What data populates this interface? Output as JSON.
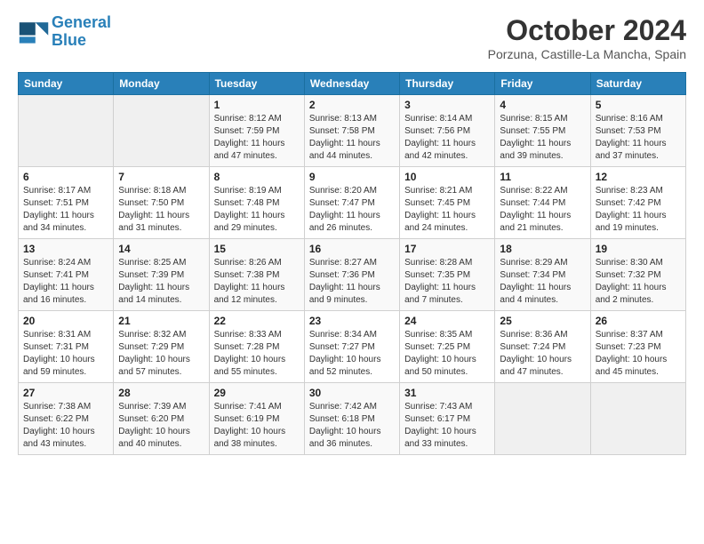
{
  "header": {
    "logo_line1": "General",
    "logo_line2": "Blue",
    "month": "October 2024",
    "location": "Porzuna, Castille-La Mancha, Spain"
  },
  "weekdays": [
    "Sunday",
    "Monday",
    "Tuesday",
    "Wednesday",
    "Thursday",
    "Friday",
    "Saturday"
  ],
  "weeks": [
    [
      {
        "day": "",
        "info": ""
      },
      {
        "day": "",
        "info": ""
      },
      {
        "day": "1",
        "info": "Sunrise: 8:12 AM\nSunset: 7:59 PM\nDaylight: 11 hours and 47 minutes."
      },
      {
        "day": "2",
        "info": "Sunrise: 8:13 AM\nSunset: 7:58 PM\nDaylight: 11 hours and 44 minutes."
      },
      {
        "day": "3",
        "info": "Sunrise: 8:14 AM\nSunset: 7:56 PM\nDaylight: 11 hours and 42 minutes."
      },
      {
        "day": "4",
        "info": "Sunrise: 8:15 AM\nSunset: 7:55 PM\nDaylight: 11 hours and 39 minutes."
      },
      {
        "day": "5",
        "info": "Sunrise: 8:16 AM\nSunset: 7:53 PM\nDaylight: 11 hours and 37 minutes."
      }
    ],
    [
      {
        "day": "6",
        "info": "Sunrise: 8:17 AM\nSunset: 7:51 PM\nDaylight: 11 hours and 34 minutes."
      },
      {
        "day": "7",
        "info": "Sunrise: 8:18 AM\nSunset: 7:50 PM\nDaylight: 11 hours and 31 minutes."
      },
      {
        "day": "8",
        "info": "Sunrise: 8:19 AM\nSunset: 7:48 PM\nDaylight: 11 hours and 29 minutes."
      },
      {
        "day": "9",
        "info": "Sunrise: 8:20 AM\nSunset: 7:47 PM\nDaylight: 11 hours and 26 minutes."
      },
      {
        "day": "10",
        "info": "Sunrise: 8:21 AM\nSunset: 7:45 PM\nDaylight: 11 hours and 24 minutes."
      },
      {
        "day": "11",
        "info": "Sunrise: 8:22 AM\nSunset: 7:44 PM\nDaylight: 11 hours and 21 minutes."
      },
      {
        "day": "12",
        "info": "Sunrise: 8:23 AM\nSunset: 7:42 PM\nDaylight: 11 hours and 19 minutes."
      }
    ],
    [
      {
        "day": "13",
        "info": "Sunrise: 8:24 AM\nSunset: 7:41 PM\nDaylight: 11 hours and 16 minutes."
      },
      {
        "day": "14",
        "info": "Sunrise: 8:25 AM\nSunset: 7:39 PM\nDaylight: 11 hours and 14 minutes."
      },
      {
        "day": "15",
        "info": "Sunrise: 8:26 AM\nSunset: 7:38 PM\nDaylight: 11 hours and 12 minutes."
      },
      {
        "day": "16",
        "info": "Sunrise: 8:27 AM\nSunset: 7:36 PM\nDaylight: 11 hours and 9 minutes."
      },
      {
        "day": "17",
        "info": "Sunrise: 8:28 AM\nSunset: 7:35 PM\nDaylight: 11 hours and 7 minutes."
      },
      {
        "day": "18",
        "info": "Sunrise: 8:29 AM\nSunset: 7:34 PM\nDaylight: 11 hours and 4 minutes."
      },
      {
        "day": "19",
        "info": "Sunrise: 8:30 AM\nSunset: 7:32 PM\nDaylight: 11 hours and 2 minutes."
      }
    ],
    [
      {
        "day": "20",
        "info": "Sunrise: 8:31 AM\nSunset: 7:31 PM\nDaylight: 10 hours and 59 minutes."
      },
      {
        "day": "21",
        "info": "Sunrise: 8:32 AM\nSunset: 7:29 PM\nDaylight: 10 hours and 57 minutes."
      },
      {
        "day": "22",
        "info": "Sunrise: 8:33 AM\nSunset: 7:28 PM\nDaylight: 10 hours and 55 minutes."
      },
      {
        "day": "23",
        "info": "Sunrise: 8:34 AM\nSunset: 7:27 PM\nDaylight: 10 hours and 52 minutes."
      },
      {
        "day": "24",
        "info": "Sunrise: 8:35 AM\nSunset: 7:25 PM\nDaylight: 10 hours and 50 minutes."
      },
      {
        "day": "25",
        "info": "Sunrise: 8:36 AM\nSunset: 7:24 PM\nDaylight: 10 hours and 47 minutes."
      },
      {
        "day": "26",
        "info": "Sunrise: 8:37 AM\nSunset: 7:23 PM\nDaylight: 10 hours and 45 minutes."
      }
    ],
    [
      {
        "day": "27",
        "info": "Sunrise: 7:38 AM\nSunset: 6:22 PM\nDaylight: 10 hours and 43 minutes."
      },
      {
        "day": "28",
        "info": "Sunrise: 7:39 AM\nSunset: 6:20 PM\nDaylight: 10 hours and 40 minutes."
      },
      {
        "day": "29",
        "info": "Sunrise: 7:41 AM\nSunset: 6:19 PM\nDaylight: 10 hours and 38 minutes."
      },
      {
        "day": "30",
        "info": "Sunrise: 7:42 AM\nSunset: 6:18 PM\nDaylight: 10 hours and 36 minutes."
      },
      {
        "day": "31",
        "info": "Sunrise: 7:43 AM\nSunset: 6:17 PM\nDaylight: 10 hours and 33 minutes."
      },
      {
        "day": "",
        "info": ""
      },
      {
        "day": "",
        "info": ""
      }
    ]
  ]
}
